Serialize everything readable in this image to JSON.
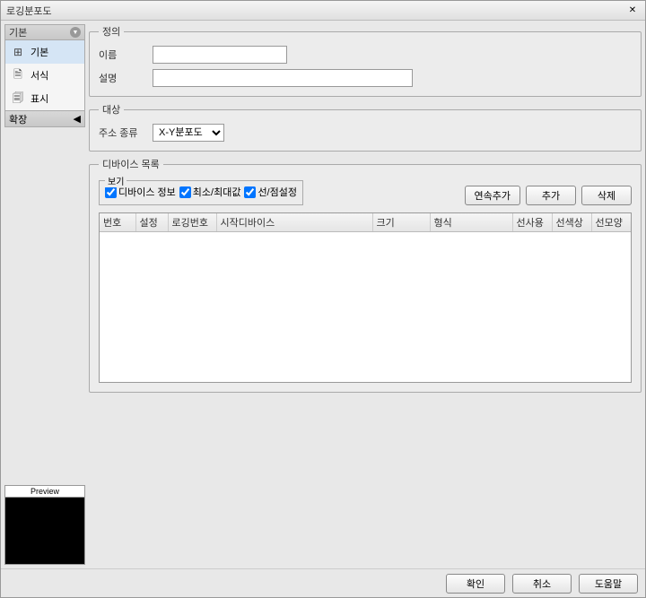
{
  "window": {
    "title": "로깅분포도"
  },
  "sidebar": {
    "basic_header": "기본",
    "items": [
      {
        "label": "기본",
        "icon": "⊞"
      },
      {
        "label": "서식",
        "icon": "🗎"
      },
      {
        "label": "표시",
        "icon": "🗐"
      }
    ],
    "expand_header": "확장",
    "preview_label": "Preview"
  },
  "definition": {
    "legend": "정의",
    "name_label": "이름",
    "name_value": "",
    "desc_label": "설명",
    "desc_value": ""
  },
  "target": {
    "legend": "대상",
    "addr_type_label": "주소 종류",
    "addr_type_value": "X-Y분포도",
    "addr_type_options": [
      "X-Y분포도"
    ]
  },
  "device_list": {
    "legend": "디바이스 목록",
    "view_label": "보기",
    "checks": [
      {
        "label": "디바이스 정보",
        "checked": true
      },
      {
        "label": "최소/최대값",
        "checked": true
      },
      {
        "label": "선/점설정",
        "checked": true
      }
    ],
    "buttons": {
      "add_seq": "연속추가",
      "add": "추가",
      "del": "삭제"
    },
    "columns": [
      "번호",
      "설정",
      "로깅번호",
      "시작디바이스",
      "크기",
      "형식",
      "선사용",
      "선색상",
      "선모양"
    ],
    "rows": []
  },
  "footer": {
    "ok": "확인",
    "cancel": "취소",
    "help": "도움말"
  }
}
